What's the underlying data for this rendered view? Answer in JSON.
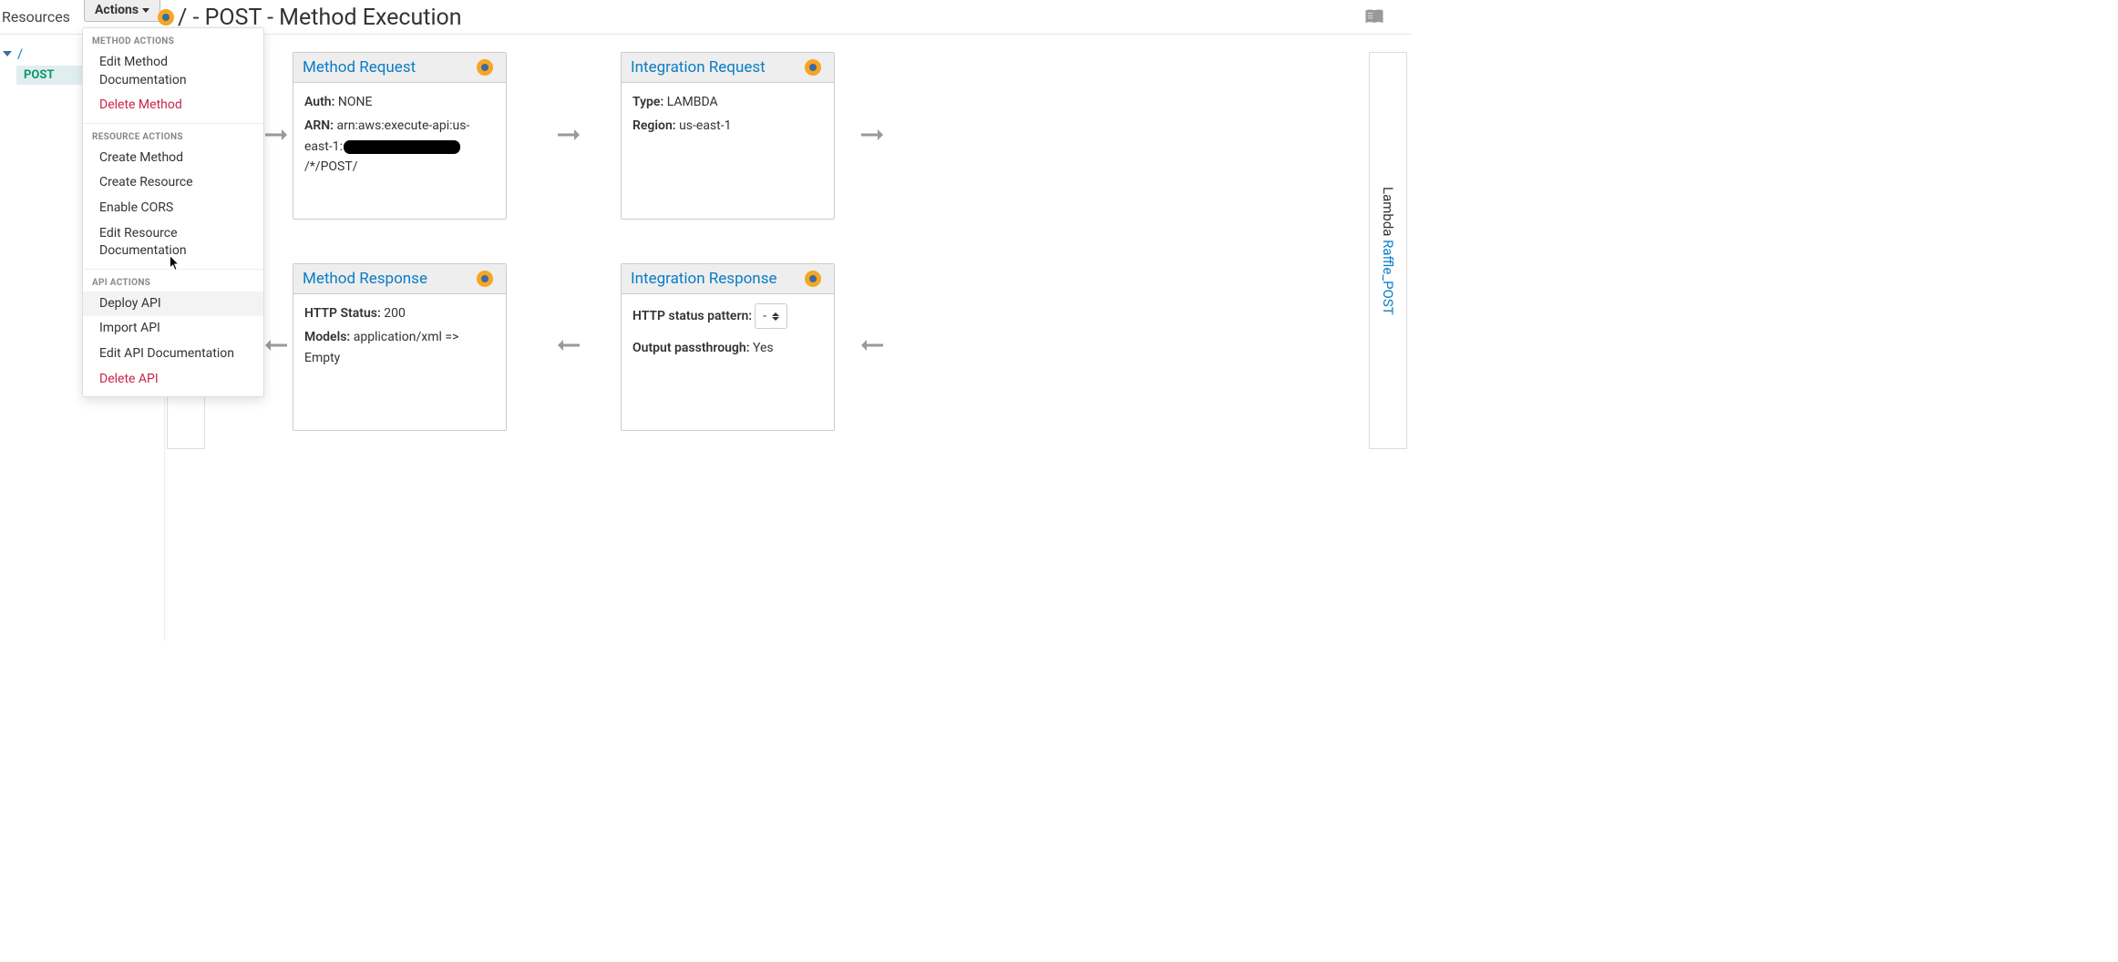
{
  "header": {
    "resources_label": "Resources",
    "actions_label": "Actions",
    "page_title": "/ - POST - Method Execution"
  },
  "tree": {
    "root": "/",
    "selected_method": "POST"
  },
  "dropdown": {
    "section1_header": "METHOD ACTIONS",
    "item_edit_method_doc": "Edit Method Documentation",
    "item_delete_method": "Delete Method",
    "section2_header": "RESOURCE ACTIONS",
    "item_create_method": "Create Method",
    "item_create_resource": "Create Resource",
    "item_enable_cors": "Enable CORS",
    "item_edit_resource_doc": "Edit Resource Documentation",
    "section3_header": "API ACTIONS",
    "item_deploy_api": "Deploy API",
    "item_import_api": "Import API",
    "item_edit_api_doc": "Edit API Documentation",
    "item_delete_api": "Delete API"
  },
  "flow": {
    "method_request": {
      "title": "Method Request",
      "auth_label": "Auth:",
      "auth_value": "NONE",
      "arn_label": "ARN:",
      "arn_prefix": "arn:aws:execute-api:us-east-1:",
      "arn_suffix": "/*/POST/"
    },
    "integration_request": {
      "title": "Integration Request",
      "type_label": "Type:",
      "type_value": "LAMBDA",
      "region_label": "Region:",
      "region_value": "us-east-1"
    },
    "method_response": {
      "title": "Method Response",
      "status_label": "HTTP Status:",
      "status_value": "200",
      "models_label": "Models:",
      "models_value": "application/xml => Empty"
    },
    "integration_response": {
      "title": "Integration Response",
      "pattern_label": "HTTP status pattern:",
      "pattern_value": "-",
      "passthrough_label": "Output passthrough:",
      "passthrough_value": "Yes"
    },
    "lambda": {
      "prefix": "Lambda ",
      "link": "Raffle_POST"
    }
  }
}
